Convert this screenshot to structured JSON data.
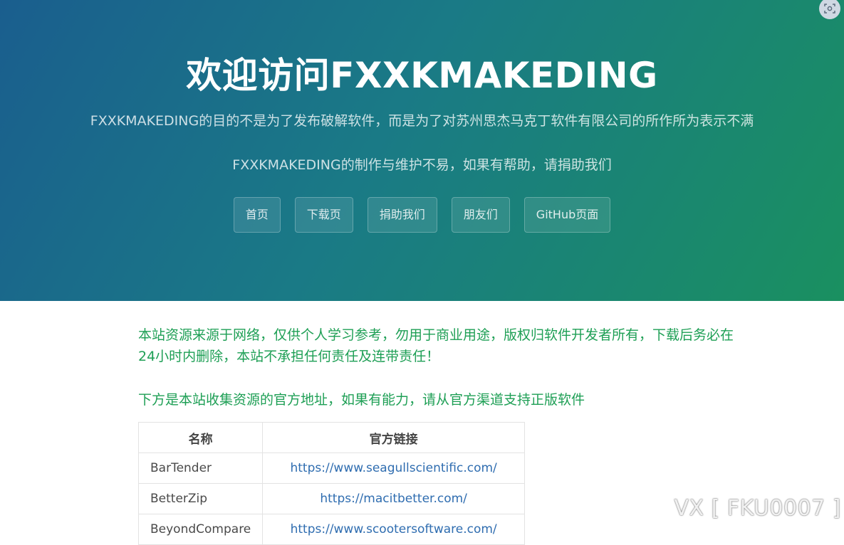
{
  "hero": {
    "title": "欢迎访问FXXKMAKEDING",
    "subtitle1": "FXXKMAKEDING的目的不是为了发布破解软件，而是为了对苏州思杰马克丁软件有限公司的所作所为表示不满",
    "subtitle2": "FXXKMAKEDING的制作与维护不易，如果有帮助，请捐助我们"
  },
  "nav": {
    "items": [
      {
        "label": "首页"
      },
      {
        "label": "下载页"
      },
      {
        "label": "捐助我们"
      },
      {
        "label": "朋友们"
      },
      {
        "label": "GitHub页面"
      }
    ]
  },
  "content": {
    "notice1": "本站资源来源于网络，仅供个人学习参考，勿用于商业用途，版权归软件开发者所有，下载后务必在24小时内删除，本站不承担任何责任及连带责任！",
    "notice2": "下方是本站收集资源的官方地址，如果有能力，请从官方渠道支持正版软件"
  },
  "table": {
    "headers": [
      "名称",
      "官方链接"
    ],
    "rows": [
      {
        "name": "BarTender",
        "url": "https://www.seagullscientific.com/"
      },
      {
        "name": "BetterZip",
        "url": "https://macitbetter.com/"
      },
      {
        "name": "BeyondCompare",
        "url": "https://www.scootersoftware.com/"
      }
    ]
  },
  "watermark": "VX [ FKU0007 ]",
  "colors": {
    "notice_text": "#1e9f55",
    "link": "#2f6db0",
    "hero_gradient_start": "#1a5e8e",
    "hero_gradient_end": "#1a9060"
  },
  "icons": {
    "corner": "screenshot-icon"
  }
}
